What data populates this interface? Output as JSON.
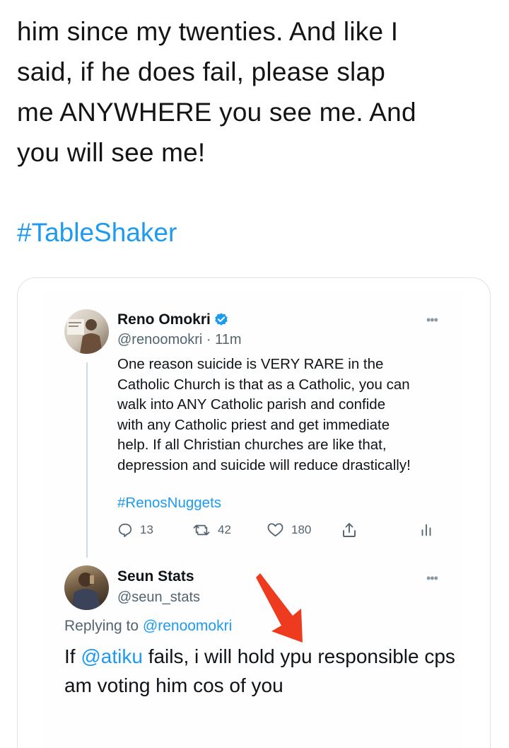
{
  "post": {
    "text_lines": [
      "him since my twenties. And like I",
      "said, if he does fail, please slap",
      "me ANYWHERE you see me. And",
      "you will see me!"
    ],
    "hashtag": "#TableShaker"
  },
  "quoted_tweet": {
    "author_name": "Reno Omokri",
    "verified_icon": "verified-badge-icon",
    "handle": "@renoomokri",
    "time": " · 11m",
    "body": "One reason suicide is VERY RARE in the\nCatholic Church is that as a Catholic, you can\nwalk into ANY Catholic parish and confide\nwith any Catholic priest and get immediate\nhelp. If all Christian churches are like that,\ndepression and suicide will reduce drastically!",
    "hashtag": "#RenosNuggets",
    "actions": {
      "reply_count": "13",
      "retweet_count": "42",
      "like_count": "180"
    }
  },
  "reply_tweet": {
    "author_name": "Seun Stats",
    "handle": "@seun_stats",
    "replying_prefix": "Replying to ",
    "replying_to": "@renoomokri",
    "text_before": "If ",
    "mention": "@atiku",
    "text_after": " fails, i will hold ypu responsible cps am voting him cos of you"
  },
  "colors": {
    "link": "#1d9bf0",
    "muted": "#536471",
    "arrow": "#ee3a1f"
  }
}
